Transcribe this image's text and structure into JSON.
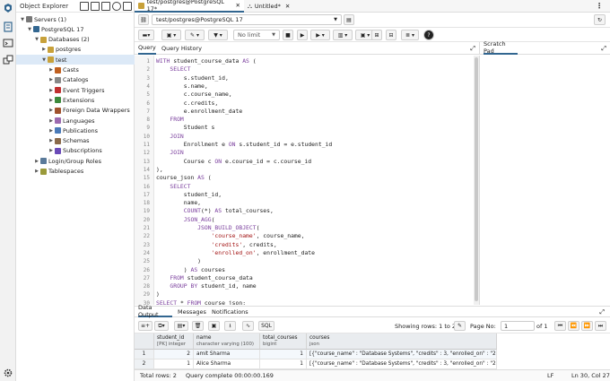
{
  "explorer": {
    "title": "Object Explorer",
    "tree": [
      {
        "label": "Servers (1)",
        "level": 0,
        "expanded": true,
        "icon": "servers-icon"
      },
      {
        "label": "PostgreSQL 17",
        "level": 1,
        "expanded": true,
        "icon": "elephant-icon"
      },
      {
        "label": "Databases (2)",
        "level": 2,
        "expanded": true,
        "icon": "databases-icon"
      },
      {
        "label": "postgres",
        "level": 3,
        "expanded": false,
        "icon": "database-icon"
      },
      {
        "label": "test",
        "level": 3,
        "expanded": true,
        "icon": "database-icon",
        "selected": true
      },
      {
        "label": "Casts",
        "level": 4,
        "expanded": false,
        "icon": "casts-icon"
      },
      {
        "label": "Catalogs",
        "level": 4,
        "expanded": false,
        "icon": "catalogs-icon"
      },
      {
        "label": "Event Triggers",
        "level": 4,
        "expanded": false,
        "icon": "event-triggers-icon"
      },
      {
        "label": "Extensions",
        "level": 4,
        "expanded": false,
        "icon": "extensions-icon"
      },
      {
        "label": "Foreign Data Wrappers",
        "level": 4,
        "expanded": false,
        "icon": "fdw-icon"
      },
      {
        "label": "Languages",
        "level": 4,
        "expanded": false,
        "icon": "languages-icon"
      },
      {
        "label": "Publications",
        "level": 4,
        "expanded": false,
        "icon": "publications-icon"
      },
      {
        "label": "Schemas",
        "level": 4,
        "expanded": false,
        "icon": "schemas-icon"
      },
      {
        "label": "Subscriptions",
        "level": 4,
        "expanded": false,
        "icon": "subscriptions-icon"
      },
      {
        "label": "Login/Group Roles",
        "level": 2,
        "expanded": false,
        "icon": "roles-icon"
      },
      {
        "label": "Tablespaces",
        "level": 2,
        "expanded": false,
        "icon": "tablespaces-icon"
      }
    ]
  },
  "tabs": [
    {
      "label": "test/postgres@PostgreSQL 17*",
      "active": true
    },
    {
      "label": "Untitled*",
      "active": false
    }
  ],
  "connection": {
    "value": "test/postgres@PostgreSQL 17"
  },
  "toolbar": {
    "limit": "No limit"
  },
  "query_tabs": {
    "query": "Query",
    "history": "Query History",
    "scratch": "Scratch Pad"
  },
  "editor": {
    "lines": [
      [
        [
          "kw",
          "WITH "
        ],
        [
          "",
          "student_course_data "
        ],
        [
          "kw",
          "AS"
        ],
        [
          "",
          " ("
        ]
      ],
      [
        [
          "",
          "    "
        ],
        [
          "kw",
          "SELECT"
        ]
      ],
      [
        [
          "",
          "        s.student_id,"
        ]
      ],
      [
        [
          "",
          "        s.name,"
        ]
      ],
      [
        [
          "",
          "        c.course_name,"
        ]
      ],
      [
        [
          "",
          "        c.credits,"
        ]
      ],
      [
        [
          "",
          "        e.enrollment_date"
        ]
      ],
      [
        [
          "",
          "    "
        ],
        [
          "kw",
          "FROM"
        ]
      ],
      [
        [
          "",
          "        Student s"
        ]
      ],
      [
        [
          "",
          "    "
        ],
        [
          "kw",
          "JOIN"
        ]
      ],
      [
        [
          "",
          "        Enrollment e "
        ],
        [
          "kw",
          "ON"
        ],
        [
          "",
          " s.student_id = e.student_id"
        ]
      ],
      [
        [
          "",
          "    "
        ],
        [
          "kw",
          "JOIN"
        ]
      ],
      [
        [
          "",
          "        Course c "
        ],
        [
          "kw",
          "ON"
        ],
        [
          "",
          " e.course_id = c.course_id"
        ]
      ],
      [
        [
          "",
          "),"
        ]
      ],
      [
        [
          "",
          "course_json "
        ],
        [
          "kw",
          "AS"
        ],
        [
          "",
          " ("
        ]
      ],
      [
        [
          "",
          "    "
        ],
        [
          "kw",
          "SELECT"
        ]
      ],
      [
        [
          "",
          "        student_id,"
        ]
      ],
      [
        [
          "",
          "        name,"
        ]
      ],
      [
        [
          "",
          "        "
        ],
        [
          "kw",
          "COUNT"
        ],
        [
          "",
          "(*) "
        ],
        [
          "kw",
          "AS"
        ],
        [
          "",
          " total_courses,"
        ]
      ],
      [
        [
          "",
          "        "
        ],
        [
          "kw",
          "JSON_AGG"
        ],
        [
          "",
          "("
        ]
      ],
      [
        [
          "",
          "            "
        ],
        [
          "kw",
          "JSON_BUILD_OBJECT"
        ],
        [
          "",
          "("
        ]
      ],
      [
        [
          "",
          "                "
        ],
        [
          "str",
          "'course_name'"
        ],
        [
          "",
          ", course_name,"
        ]
      ],
      [
        [
          "",
          "                "
        ],
        [
          "str",
          "'credits'"
        ],
        [
          "",
          ", credits,"
        ]
      ],
      [
        [
          "",
          "                "
        ],
        [
          "str",
          "'enrolled_on'"
        ],
        [
          "",
          ", enrollment_date"
        ]
      ],
      [
        [
          "",
          "            )"
        ]
      ],
      [
        [
          "",
          "        ) "
        ],
        [
          "kw",
          "AS"
        ],
        [
          "",
          " courses"
        ]
      ],
      [
        [
          "",
          "    "
        ],
        [
          "kw",
          "FROM"
        ],
        [
          "",
          " student_course_data"
        ]
      ],
      [
        [
          "",
          "    "
        ],
        [
          "kw",
          "GROUP BY"
        ],
        [
          "",
          " student_id, name"
        ]
      ],
      [
        [
          "",
          ")"
        ]
      ],
      [
        [
          "kw",
          "SELECT"
        ],
        [
          "",
          " * "
        ],
        [
          "kw",
          "FROM"
        ],
        [
          "",
          " course_json;"
        ]
      ]
    ]
  },
  "results": {
    "tabs": [
      "Data Output",
      "Messages",
      "Notifications"
    ],
    "showing": "Showing rows: 1 to 2",
    "page_label": "Page No:",
    "page_value": "1",
    "of_label": "of 1",
    "sql_label": "SQL",
    "columns": [
      {
        "name": "student_id",
        "sub": "[PK] integer"
      },
      {
        "name": "name",
        "sub": "character varying (100)"
      },
      {
        "name": "total_courses",
        "sub": "bigint"
      },
      {
        "name": "courses",
        "sub": "json"
      }
    ],
    "rows": [
      [
        "1",
        "2",
        "amit Sharma",
        "1",
        "[{\"course_name\" : \"Database Systems\", \"credits\" : 3, \"enrolled_on\" : \"2025-06-02\"}]"
      ],
      [
        "2",
        "1",
        "Alice Sharma",
        "1",
        "[{\"course_name\" : \"Database Systems\", \"credits\" : 3, \"enrolled_on\" : \"2025-06-02\"}]"
      ]
    ]
  },
  "status": {
    "total_rows": "Total rows: 2",
    "query_complete": "Query complete 00:00:00.169",
    "line_ending": "LF",
    "position": "Ln 30, Col 27"
  },
  "colors": {
    "accent": "#326690",
    "selected": "#dce9f7",
    "keyword": "#7a3e9d",
    "string": "#a31515"
  }
}
